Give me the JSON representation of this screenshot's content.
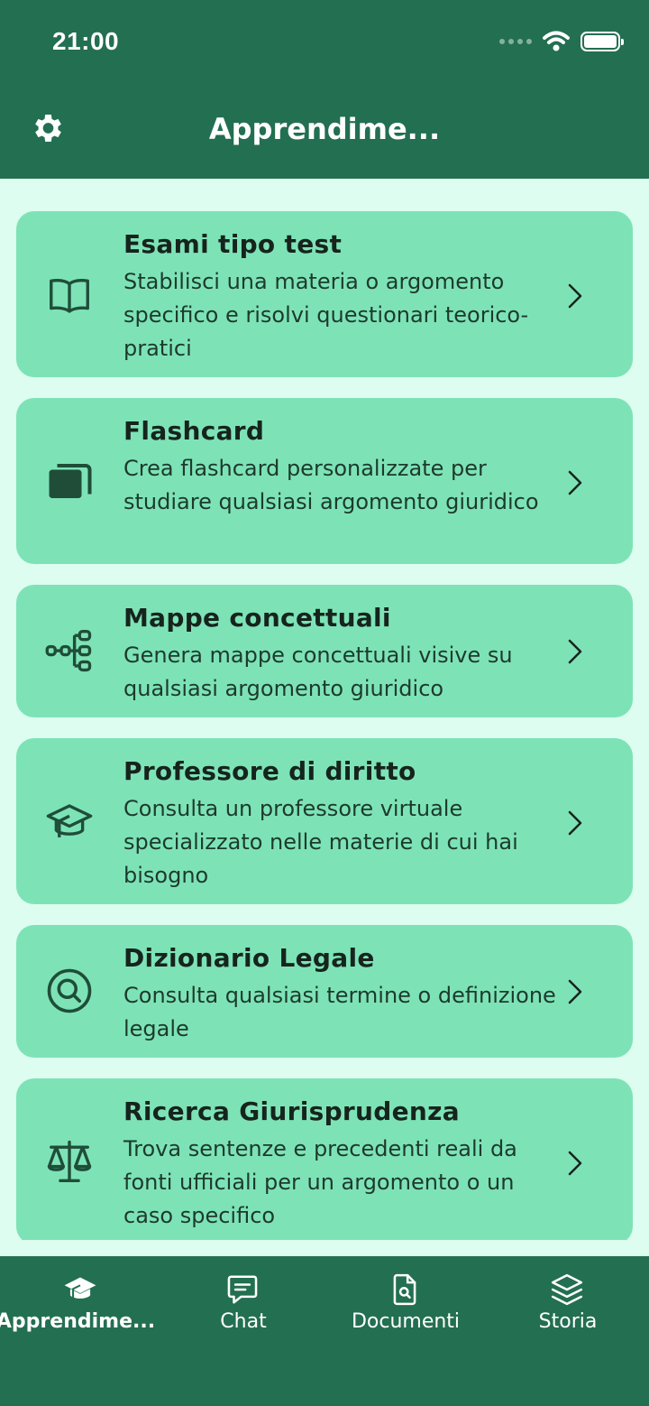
{
  "status_bar": {
    "time": "21:00"
  },
  "header": {
    "title": "Apprendime..."
  },
  "cards": [
    {
      "title": "Esami tipo test",
      "description": "Stabilisci una materia o argomento specifico e risolvi questionari teorico-pratici",
      "icon": "book-icon"
    },
    {
      "title": "Flashcard",
      "description": "Crea flashcard personalizzate per studiare qualsiasi argomento giuridico",
      "icon": "flashcards-icon"
    },
    {
      "title": "Mappe concettuali",
      "description": "Genera mappe concettuali visive su qualsiasi argomento giuridico",
      "icon": "mind-map-icon"
    },
    {
      "title": "Professore di diritto",
      "description": "Consulta un professore virtuale specializzato nelle materie di cui hai bisogno",
      "icon": "graduation-cap-icon"
    },
    {
      "title": "Dizionario Legale",
      "description": "Consulta qualsiasi termine o definizione legale",
      "icon": "search-circle-icon"
    },
    {
      "title": "Ricerca Giurisprudenza",
      "description": "Trova sentenze e precedenti reali da fonti ufficiali per un argomento o un caso specifico",
      "icon": "scales-icon"
    }
  ],
  "tabs": [
    {
      "label": "Apprendime...",
      "icon": "graduation-cap-icon",
      "active": true
    },
    {
      "label": "Chat",
      "icon": "chat-icon",
      "active": false
    },
    {
      "label": "Documenti",
      "icon": "document-search-icon",
      "active": false
    },
    {
      "label": "Storia",
      "icon": "layers-icon",
      "active": false
    }
  ],
  "colors": {
    "header": "#236f51",
    "background": "#dcfdf0",
    "card": "#7de3b7",
    "text": "#16241d"
  }
}
